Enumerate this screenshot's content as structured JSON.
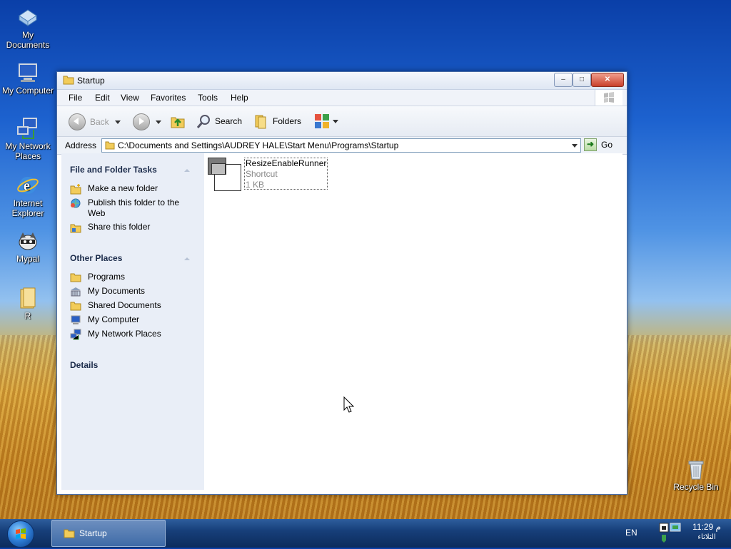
{
  "desktop": {
    "icons": [
      {
        "label": "My Documents",
        "icon": "my-documents-icon"
      },
      {
        "label": "My Computer",
        "icon": "my-computer-icon"
      },
      {
        "label": "My Network Places",
        "icon": "network-places-icon"
      },
      {
        "label": "Internet Explorer",
        "icon": "internet-explorer-icon"
      },
      {
        "label": "Mypal",
        "icon": "mypal-icon"
      },
      {
        "label": "R",
        "icon": "folder-icon"
      },
      {
        "label": "Recycle Bin",
        "icon": "recycle-bin-icon"
      }
    ]
  },
  "window": {
    "title": "Startup",
    "controls": {
      "minimize": "–",
      "maximize": "□",
      "close": "✕"
    },
    "menu": [
      "File",
      "Edit",
      "View",
      "Favorites",
      "Tools",
      "Help"
    ],
    "toolbar": {
      "back": "Back",
      "search": "Search",
      "folders": "Folders"
    },
    "address": {
      "label": "Address",
      "path": "C:\\Documents and Settings\\AUDREY HALE\\Start Menu\\Programs\\Startup",
      "go": "Go"
    },
    "taskpane": {
      "file_folder_tasks": {
        "title": "File and Folder Tasks",
        "items": [
          "Make a new folder",
          "Publish this folder to the Web",
          "Share this folder"
        ]
      },
      "other_places": {
        "title": "Other Places",
        "items": [
          "Programs",
          "My Documents",
          "Shared Documents",
          "My Computer",
          "My Network Places"
        ]
      },
      "details": {
        "title": "Details"
      }
    },
    "files": [
      {
        "name": "ResizeEnableRunner",
        "type": "Shortcut",
        "size": "1 KB"
      }
    ]
  },
  "taskbar": {
    "task": "Startup",
    "lang": "EN",
    "time": "11:29 م",
    "day": "الثلاثاء"
  }
}
